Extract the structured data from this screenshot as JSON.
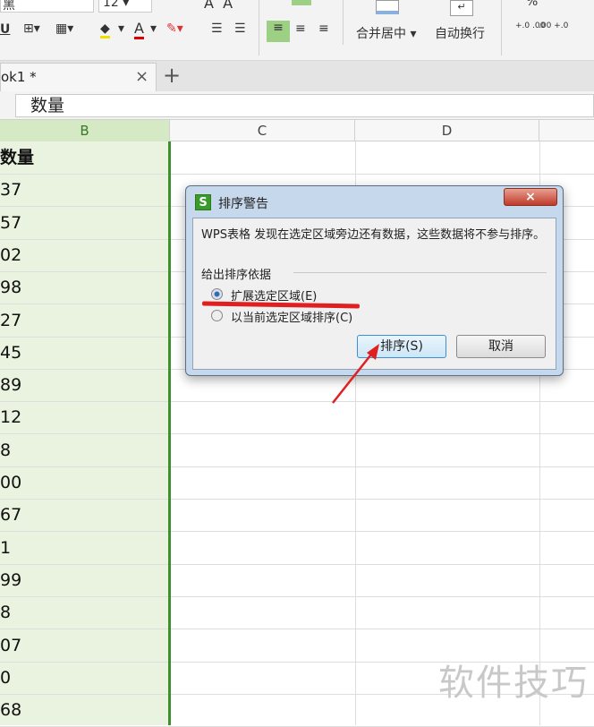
{
  "toolbar": {
    "font_name": "黑",
    "font_size": "12",
    "merge_center": "合并居中",
    "wrap_text": "自动换行",
    "dec_inc": "+.0 .00",
    "dec_dec": ".00 +.0",
    "percent": "%"
  },
  "tab": {
    "title": "ok1 *",
    "close": "×",
    "add": "+"
  },
  "formula_bar": {
    "value": "数量"
  },
  "columns": [
    "B",
    "C",
    "D"
  ],
  "column_b": [
    "数量",
    "37",
    "57",
    "02",
    "98",
    "27",
    "45",
    "89",
    "12",
    "8",
    "00",
    "67",
    "1",
    "99",
    "8",
    "07",
    "0",
    "68"
  ],
  "dialog": {
    "title": "排序警告",
    "message": "WPS表格 发现在选定区域旁边还有数据，这些数据将不参与排序。",
    "group_label": "给出排序依据",
    "options": [
      {
        "label": "扩展选定区域(E)",
        "selected": true
      },
      {
        "label": "以当前选定区域排序(C)",
        "selected": false
      }
    ],
    "sort_button": "排序(S)",
    "cancel_button": "取消",
    "close": "×"
  },
  "watermark": "软件技巧",
  "colors": {
    "selection": "#e9f3df",
    "selection_border": "#3f8f2f",
    "annotation": "#e02020"
  }
}
